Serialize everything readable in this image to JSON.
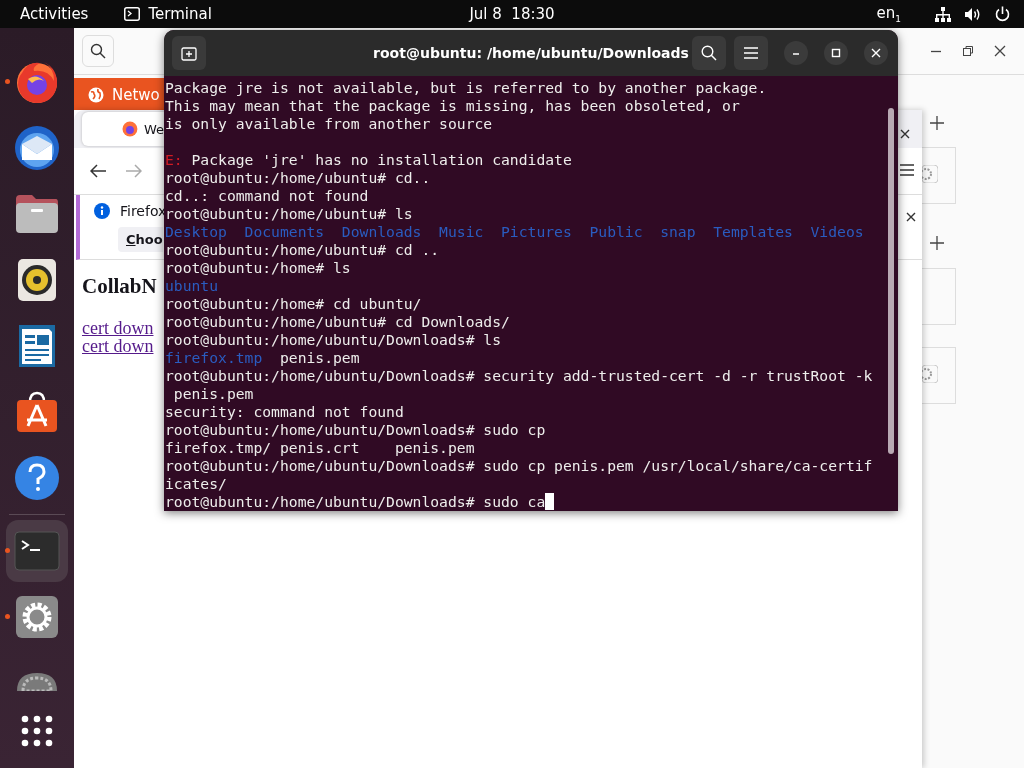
{
  "top_bar": {
    "activities": "Activities",
    "app": "Terminal",
    "clock": "Jul 8  18:30",
    "keyboard": "en$_{1}$"
  },
  "dock": {
    "items": [
      {
        "kind": "browser",
        "running": true,
        "selected": false
      },
      {
        "kind": "mail",
        "running": false,
        "selected": false
      },
      {
        "kind": "folder",
        "running": false,
        "selected": false
      },
      {
        "kind": "speaker",
        "running": false,
        "selected": false
      },
      {
        "kind": "document",
        "running": false,
        "selected": false
      },
      {
        "kind": "store",
        "running": false,
        "selected": false
      },
      {
        "kind": "help",
        "running": false,
        "selected": false
      },
      {
        "kind": "terminal",
        "running": true,
        "selected": true
      },
      {
        "kind": "gear",
        "running": true,
        "selected": false
      },
      {
        "kind": "disc",
        "running": false,
        "selected": false
      },
      {
        "kind": "apps",
        "running": false,
        "selected": false
      }
    ]
  },
  "background_window": {
    "row_label": "Netwo"
  },
  "browser": {
    "tab": {
      "title": "We",
      "selected": true
    },
    "notification": {
      "text": "Firefox",
      "button": "Choo"
    },
    "page": {
      "heading": "CollabN",
      "links": [
        "cert down",
        "cert down"
      ]
    }
  },
  "terminal": {
    "title": "root@ubuntu: /home/ubuntu/Downloads",
    "lines": [
      {
        "segments": [
          {
            "kind": "text",
            "text": "Package jre is not available, but is referred to by another package."
          }
        ]
      },
      {
        "segments": [
          {
            "kind": "text",
            "text": "This may mean that the package is missing, has been obsoleted, or"
          }
        ]
      },
      {
        "segments": [
          {
            "kind": "text",
            "text": "is only available from another source"
          }
        ]
      },
      {
        "blank_before": true,
        "segments": [
          {
            "kind": "error",
            "text": "E:"
          },
          {
            "kind": "text",
            "text": " Package 'jre' has no installation candidate"
          }
        ]
      },
      {
        "segments": [
          {
            "kind": "text",
            "text": "root@ubuntu:/home/ubuntu# cd.."
          }
        ]
      },
      {
        "segments": [
          {
            "kind": "text",
            "text": "cd..: command not found"
          }
        ]
      },
      {
        "segments": [
          {
            "kind": "text",
            "text": "root@ubuntu:/home/ubuntu# ls"
          }
        ]
      },
      {
        "segments": [
          {
            "kind": "dir",
            "text": "Desktop  Documents  Downloads  Music  Pictures  Public  snap  Templates  Videos"
          }
        ]
      },
      {
        "segments": [
          {
            "kind": "text",
            "text": "root@ubuntu:/home/ubuntu# cd .."
          }
        ]
      },
      {
        "segments": [
          {
            "kind": "text",
            "text": "root@ubuntu:/home# ls"
          }
        ]
      },
      {
        "segments": [
          {
            "kind": "dir",
            "text": "ubuntu"
          }
        ]
      },
      {
        "segments": [
          {
            "kind": "text",
            "text": "root@ubuntu:/home# cd ubuntu/"
          }
        ]
      },
      {
        "segments": [
          {
            "kind": "text",
            "text": "root@ubuntu:/home/ubuntu# cd Downloads/"
          }
        ]
      },
      {
        "segments": [
          {
            "kind": "text",
            "text": "root@ubuntu:/home/ubuntu/Downloads# ls"
          }
        ]
      },
      {
        "segments": [
          {
            "kind": "dir",
            "text": "firefox.tmp"
          },
          {
            "kind": "text",
            "text": "  penis.pem"
          }
        ]
      },
      {
        "segments": [
          {
            "kind": "text",
            "text": "root@ubuntu:/home/ubuntu/Downloads# security add-trusted-cert -d -r trustRoot -k"
          }
        ]
      },
      {
        "segments": [
          {
            "kind": "text",
            "text": " penis.pem"
          }
        ]
      },
      {
        "segments": [
          {
            "kind": "text",
            "text": "security: command not found"
          }
        ]
      },
      {
        "segments": [
          {
            "kind": "text",
            "text": "root@ubuntu:/home/ubuntu/Downloads# sudo cp"
          }
        ]
      },
      {
        "segments": [
          {
            "kind": "text",
            "text": "firefox.tmp/ penis.crt    penis.pem"
          }
        ]
      },
      {
        "segments": [
          {
            "kind": "text",
            "text": "root@ubuntu:/home/ubuntu/Downloads# sudo cp penis.pem /usr/local/share/ca-certif"
          }
        ]
      },
      {
        "segments": [
          {
            "kind": "text",
            "text": "icates/"
          }
        ]
      },
      {
        "cursor": true,
        "segments": [
          {
            "kind": "text",
            "text": "root@ubuntu:/home/ubuntu/Downloads# sudo ca"
          }
        ]
      }
    ]
  }
}
